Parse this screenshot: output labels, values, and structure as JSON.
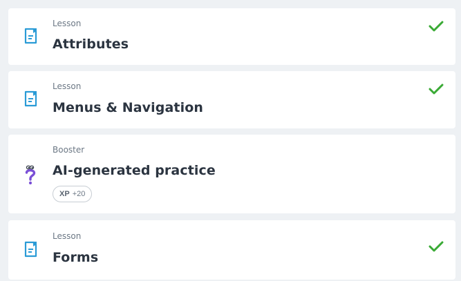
{
  "colors": {
    "background": "#eef1f4",
    "card": "#ffffff",
    "lesson_icon": "#2a9bd6",
    "booster_icon": "#7a4fd6",
    "check": "#3aaa35",
    "title_text": "#2b3440",
    "type_text": "#6b7784"
  },
  "items": [
    {
      "type": "Lesson",
      "title": "Attributes",
      "icon": "lesson-document-icon",
      "completed": true
    },
    {
      "type": "Lesson",
      "title": "Menus & Navigation",
      "icon": "lesson-document-icon",
      "completed": true
    },
    {
      "type": "Booster",
      "title": "AI-generated practice",
      "icon": "booster-question-icon",
      "completed": false,
      "xp": {
        "label": "XP",
        "value": "+20"
      }
    },
    {
      "type": "Lesson",
      "title": "Forms",
      "icon": "lesson-document-icon",
      "completed": true
    }
  ]
}
